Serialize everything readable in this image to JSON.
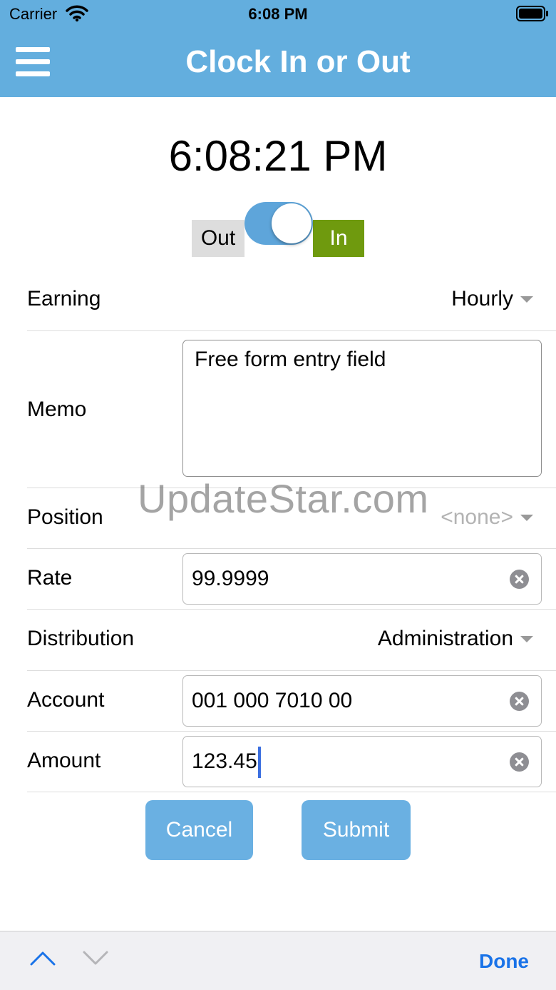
{
  "status_bar": {
    "carrier": "Carrier",
    "time": "6:08 PM"
  },
  "nav": {
    "title": "Clock In or Out",
    "menu_icon": "hamburger-menu-icon"
  },
  "clock": {
    "time": "6:08:21 PM"
  },
  "toggle": {
    "out_label": "Out",
    "in_label": "In",
    "state": "In",
    "in_color": "#6f9a0e",
    "switch_color": "#5ea5da"
  },
  "form": {
    "earning": {
      "label": "Earning",
      "value": "Hourly"
    },
    "memo": {
      "label": "Memo",
      "value": "Free form entry field"
    },
    "position": {
      "label": "Position",
      "value": "<none>"
    },
    "rate": {
      "label": "Rate",
      "value": "99.9999"
    },
    "distribution": {
      "label": "Distribution",
      "value": "Administration"
    },
    "account": {
      "label": "Account",
      "value": "001 000 7010 00"
    },
    "amount": {
      "label": "Amount",
      "value": "123.45"
    }
  },
  "buttons": {
    "cancel": "Cancel",
    "submit": "Submit"
  },
  "watermark": "UpdateStar.com",
  "keyboard_accessory": {
    "done": "Done",
    "prev_icon": "chevron-up-icon",
    "next_icon": "chevron-down-icon"
  },
  "colors": {
    "header": "#63aede",
    "button": "#6ab0e2",
    "done": "#1a73e8"
  }
}
